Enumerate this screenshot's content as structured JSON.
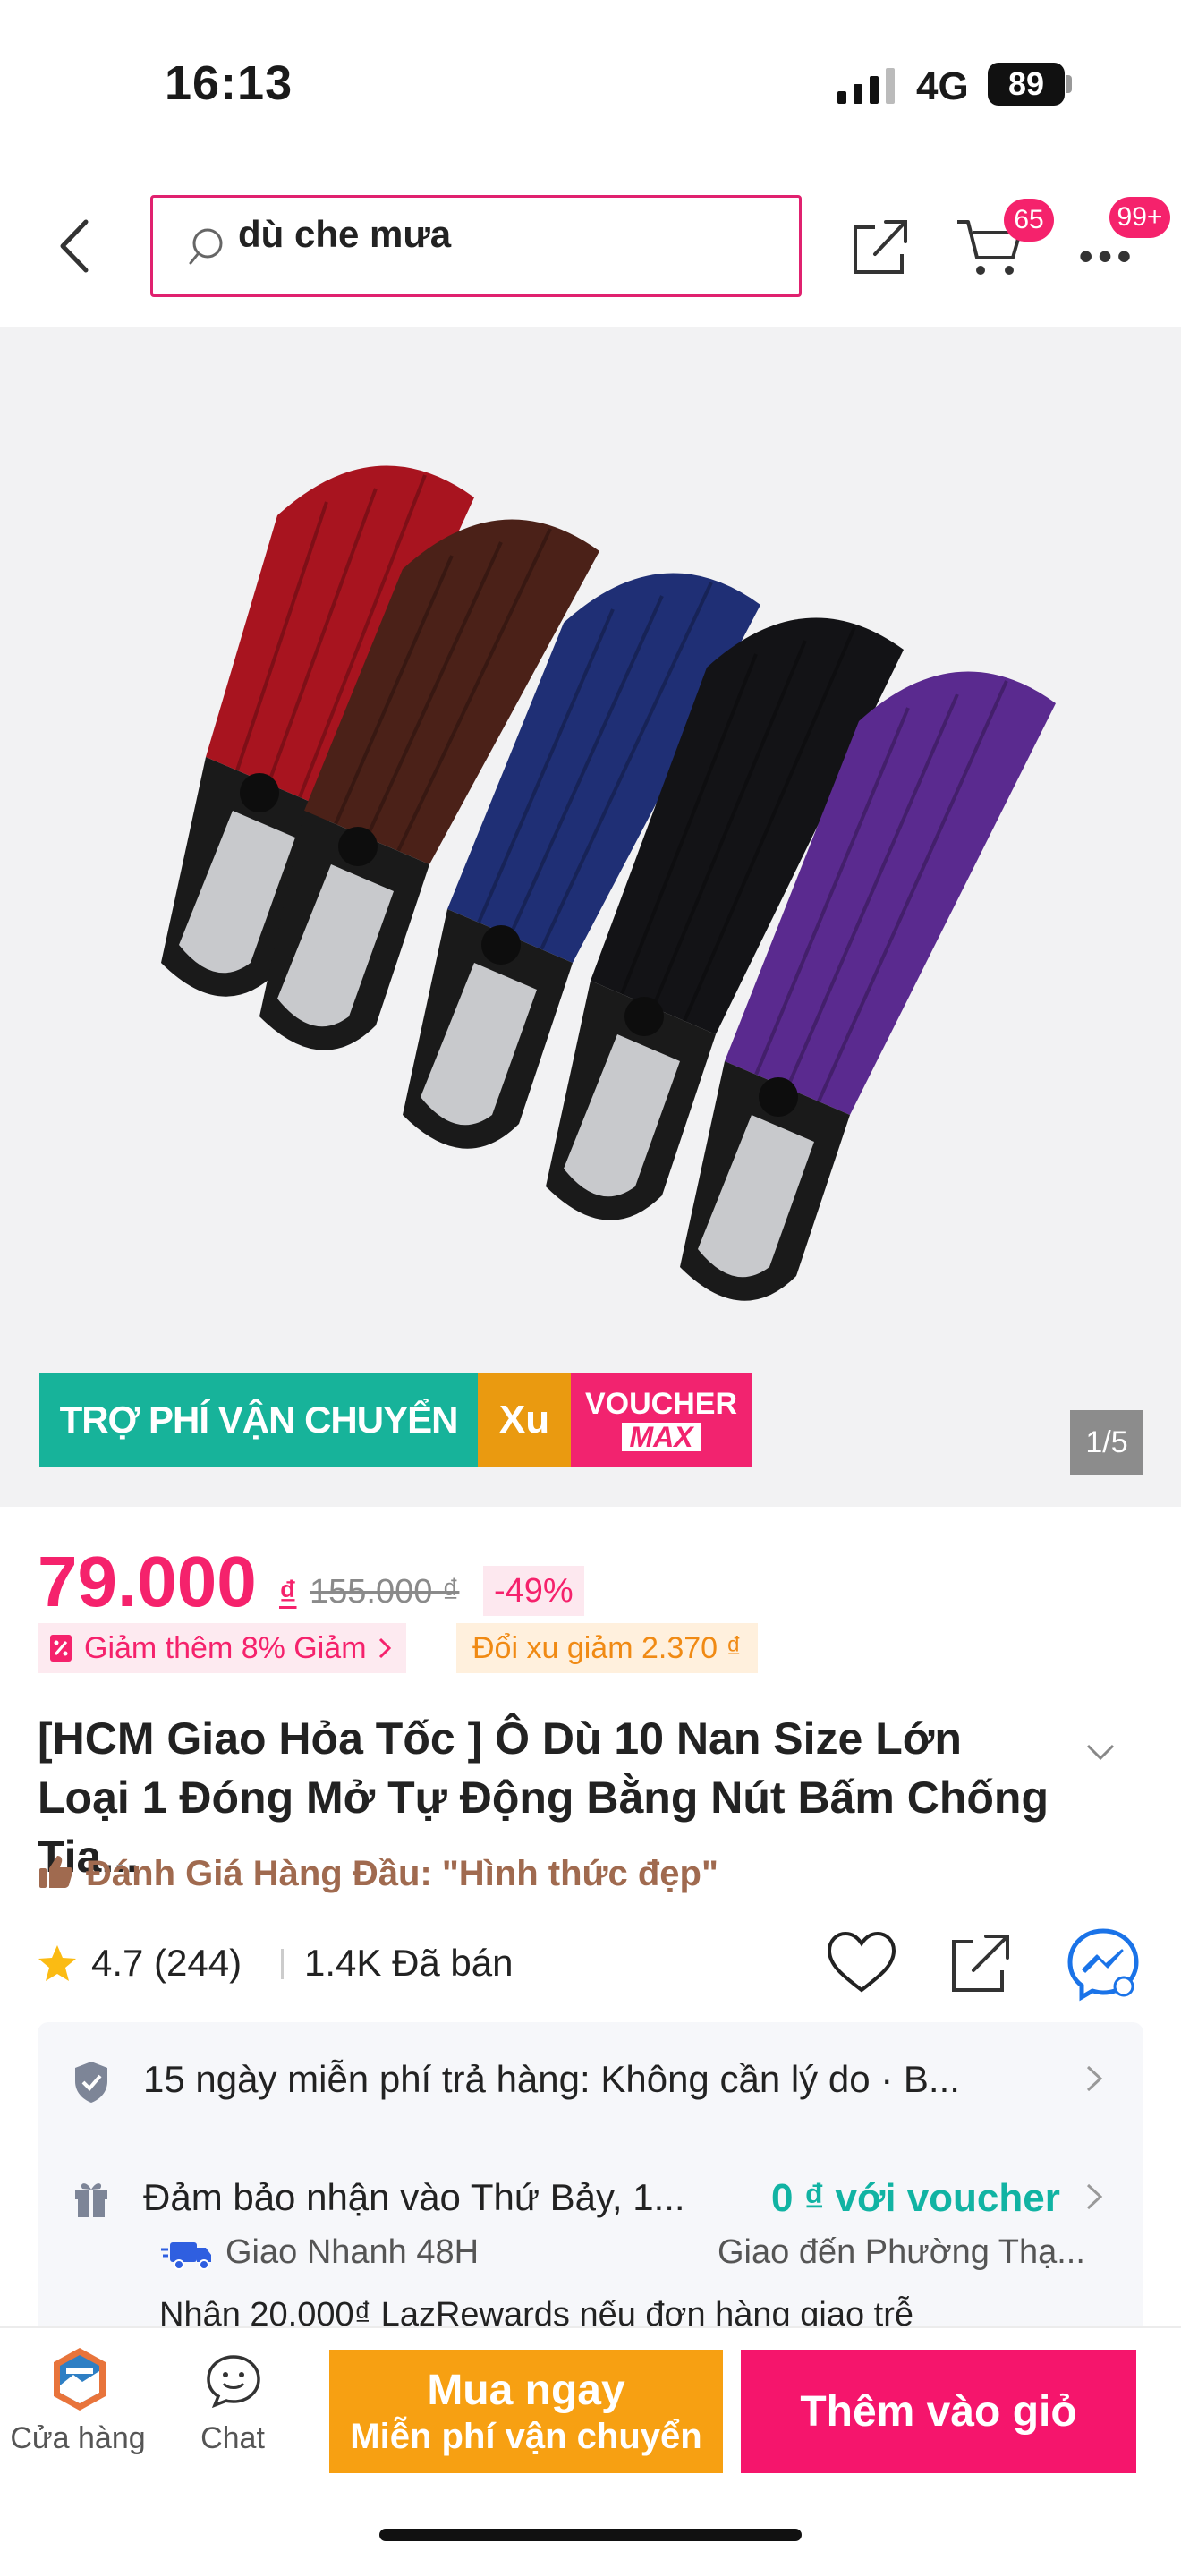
{
  "status_bar": {
    "time": "16:13",
    "network": "4G",
    "battery": "89"
  },
  "header": {
    "search_value": "dù che mưa",
    "cart_badge": "65",
    "more_badge": "99+"
  },
  "gallery": {
    "promo": {
      "shipping": "TRỢ PHÍ VẬN CHUYỂN",
      "xu": "Xu",
      "voucher_line1": "VOUCHER",
      "voucher_line2": "MAX"
    },
    "counter": "1/5",
    "umbrella_colors": [
      "#a8141f",
      "#4b2118",
      "#1f2f75",
      "#131316",
      "#5a2a8f"
    ]
  },
  "price": {
    "current": "79.000",
    "currency": "₫",
    "original": "155.000 ₫",
    "discount": "-49%",
    "extra_discount": "Giảm thêm 8% Giảm",
    "xu_discount": "Đổi xu giảm 2.370 ₫"
  },
  "product": {
    "title": "[HCM Giao Hỏa Tốc ] Ô Dù 10 Nan Size Lớn Loại 1 Đóng Mở Tự Động Bằng Nút Bấm Chống Tia...",
    "top_review": "Đánh Giá Hàng Đầu: \"Hình thức đẹp\"",
    "rating": "4.7 (244)",
    "sold": "1.4K Đã bán"
  },
  "info": {
    "return_policy": "15 ngày miễn phí trả hàng: Không cần lý do · B...",
    "delivery": "Đảm bảo nhận vào Thứ Bảy, 1...",
    "voucher": "0 ₫ với voucher",
    "fast_delivery": "Giao Nhanh 48H",
    "deliver_to": "Giao đến Phường Thạ...",
    "reward": "Nhận 20.000₫ LazRewards nếu đơn hàng giao trễ"
  },
  "bottom_bar": {
    "store_label": "Cửa hàng",
    "chat_label": "Chat",
    "buy_now": "Mua ngay",
    "buy_now_sub": "Miễn phí vận chuyển",
    "add_to_cart": "Thêm vào giỏ"
  },
  "colors": {
    "accent": "#f5226c",
    "voucher": "#11b3a3",
    "buy": "#f7a012"
  }
}
